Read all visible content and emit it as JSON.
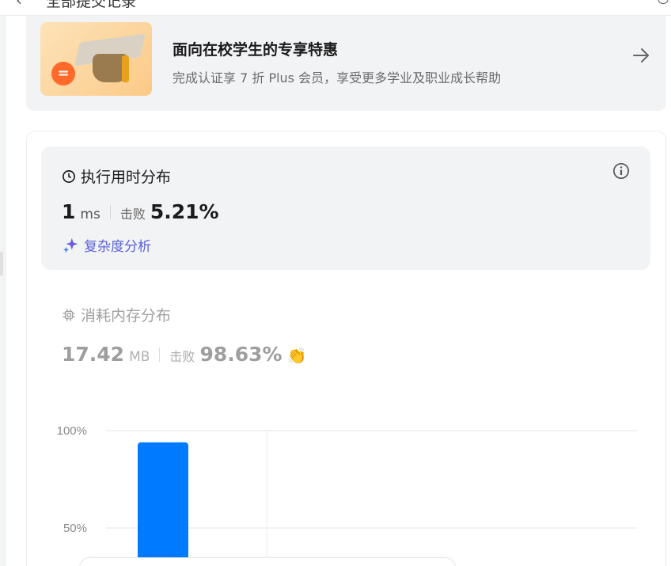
{
  "topbar": {
    "back_icon": "chevron-left-icon",
    "title": "全部提交记录",
    "right_icon": "search-icon"
  },
  "promo": {
    "title": "面向在校学生的专享特惠",
    "subtitle": "完成认证享 7 折 Plus 会员，享受更多学业及职业成长帮助",
    "arrow_icon": "arrow-right-icon",
    "image": "graduation-cap-illustration"
  },
  "runtime": {
    "heading": "执行用时分布",
    "value": "1",
    "unit": "ms",
    "beat_label": "击败",
    "beat_percent": "5.21%",
    "analysis_label": "复杂度分析",
    "icons": {
      "clock": "clock-icon",
      "info": "info-icon",
      "spark": "sparkle-icon"
    },
    "accent_color": "#5b63d8"
  },
  "memory": {
    "heading": "消耗内存分布",
    "value": "17.42",
    "unit": "MB",
    "beat_label": "击败",
    "beat_percent": "98.63%",
    "icons": {
      "chip": "chip-icon",
      "clap": "clapping-hands-icon"
    }
  },
  "chart_data": {
    "type": "bar",
    "y_ticks": [
      "100%",
      "50%"
    ],
    "ylim": [
      0,
      100
    ],
    "bars": [
      {
        "value": 94,
        "color": "#007aff"
      }
    ]
  }
}
